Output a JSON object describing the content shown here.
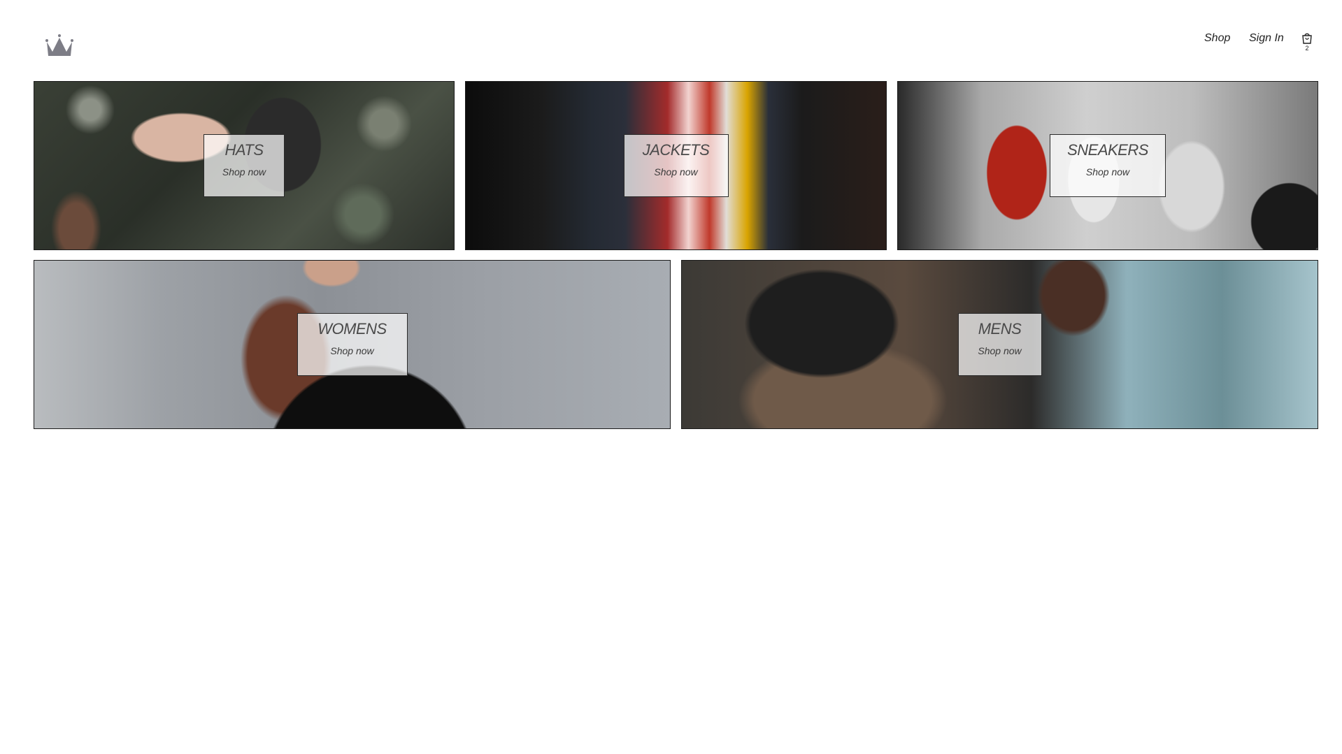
{
  "header": {
    "logo_icon": "crown-icon",
    "nav": {
      "shop_label": "Shop",
      "signin_label": "Sign In"
    },
    "cart": {
      "icon": "shopping-bag-icon",
      "count": "2"
    }
  },
  "categories": [
    {
      "title": "HATS",
      "cta": "Shop now"
    },
    {
      "title": "JACKETS",
      "cta": "Shop now"
    },
    {
      "title": "SNEAKERS",
      "cta": "Shop now"
    },
    {
      "title": "WOMENS",
      "cta": "Shop now"
    },
    {
      "title": "MENS",
      "cta": "Shop now"
    }
  ],
  "colors": {
    "border": "#1b1b1b",
    "label_bg": "#ffffffb8",
    "text": "#222222"
  }
}
